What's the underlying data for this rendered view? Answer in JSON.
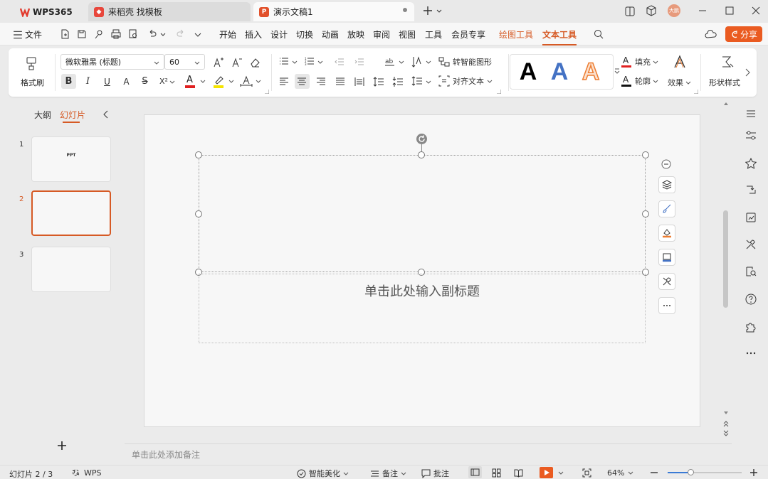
{
  "tabs": [
    {
      "label": "WPS365"
    },
    {
      "label": "来稻壳 找模板"
    },
    {
      "label": "演示文稿1"
    }
  ],
  "menu": [
    "文件",
    "开始",
    "插入",
    "设计",
    "切换",
    "动画",
    "放映",
    "审阅",
    "视图",
    "工具",
    "会员专享",
    "绘图工具",
    "文本工具"
  ],
  "share_label": "分享",
  "user_avatar": "大鹏",
  "ribbon": {
    "format_painter": "格式刷",
    "font_name": "微软雅黑 (标题)",
    "font_size": "60",
    "smartart": "转智能图形",
    "align_text": "对齐文本",
    "fill": "填充",
    "outline": "轮廓",
    "effects": "效果",
    "shape_style": "形状样式",
    "style_letter": "A"
  },
  "panel": {
    "tab_outline": "大纲",
    "tab_slides": "幻灯片",
    "slides": [
      {
        "num": "1",
        "text": "PPT"
      },
      {
        "num": "2",
        "text": ""
      },
      {
        "num": "3",
        "text": ""
      }
    ]
  },
  "slide": {
    "subtitle_placeholder": "单击此处输入副标题"
  },
  "notes_placeholder": "单击此处添加备注",
  "status": {
    "slide_counter": "幻灯片 2 / 3",
    "wps_label": "WPS",
    "smart_beautify": "智能美化",
    "notes": "备注",
    "comments": "批注",
    "zoom": "64%"
  },
  "colors": {
    "accent": "#d65a25",
    "font_color_bar": "#e02020",
    "highlight_bar": "#f5e400",
    "style_blue": "#4472c4",
    "style_orange": "#ed7d31"
  }
}
